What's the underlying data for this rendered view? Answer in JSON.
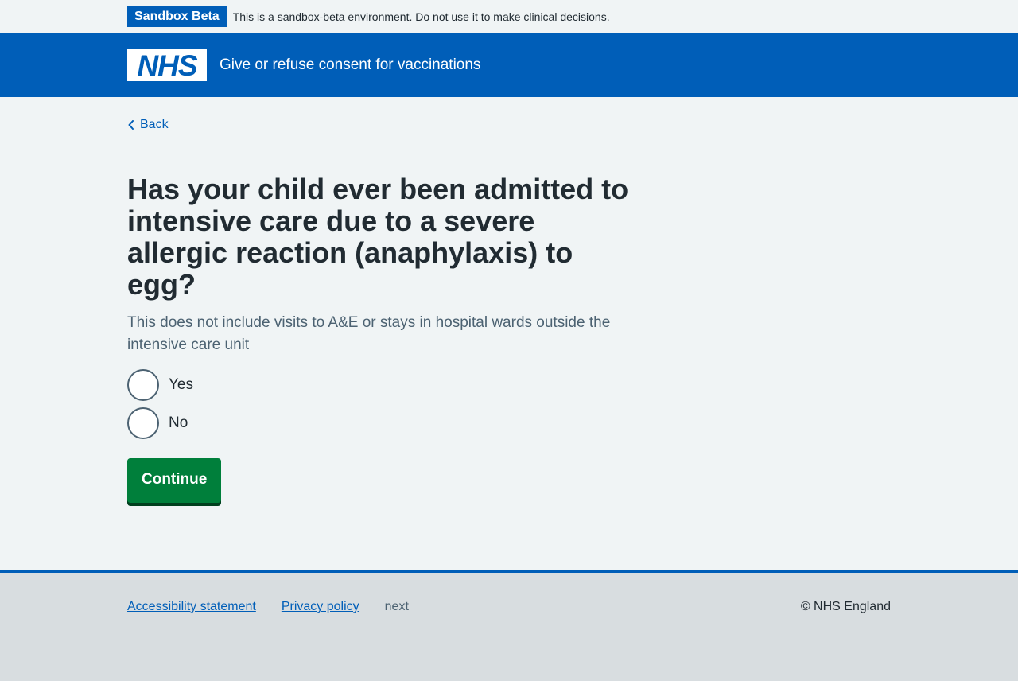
{
  "environment_banner": {
    "tag": "Sandbox Beta",
    "text": "This is a sandbox-beta environment. Do not use it to make clinical decisions."
  },
  "header": {
    "logo_text": "NHS",
    "service_name": "Give or refuse consent for vaccinations"
  },
  "main": {
    "back_label": "Back",
    "question": "Has your child ever been admitted to intensive care due to a severe allergic reaction (anaphylaxis) to egg?",
    "hint": "This does not include visits to A&E or stays in hospital wards outside the intensive care unit",
    "options": [
      {
        "label": "Yes"
      },
      {
        "label": "No"
      }
    ],
    "continue_label": "Continue"
  },
  "footer": {
    "links": [
      {
        "label": "Accessibility statement"
      },
      {
        "label": "Privacy policy"
      }
    ],
    "muted_text": "next",
    "copyright": "© NHS England"
  },
  "colors": {
    "nhs_blue": "#005eb8",
    "button_green": "#007f3b",
    "background": "#f0f4f5",
    "footer_background": "#d8dde0"
  },
  "icons": {
    "back": "chevron-left-icon",
    "logo": "nhs-logo"
  }
}
